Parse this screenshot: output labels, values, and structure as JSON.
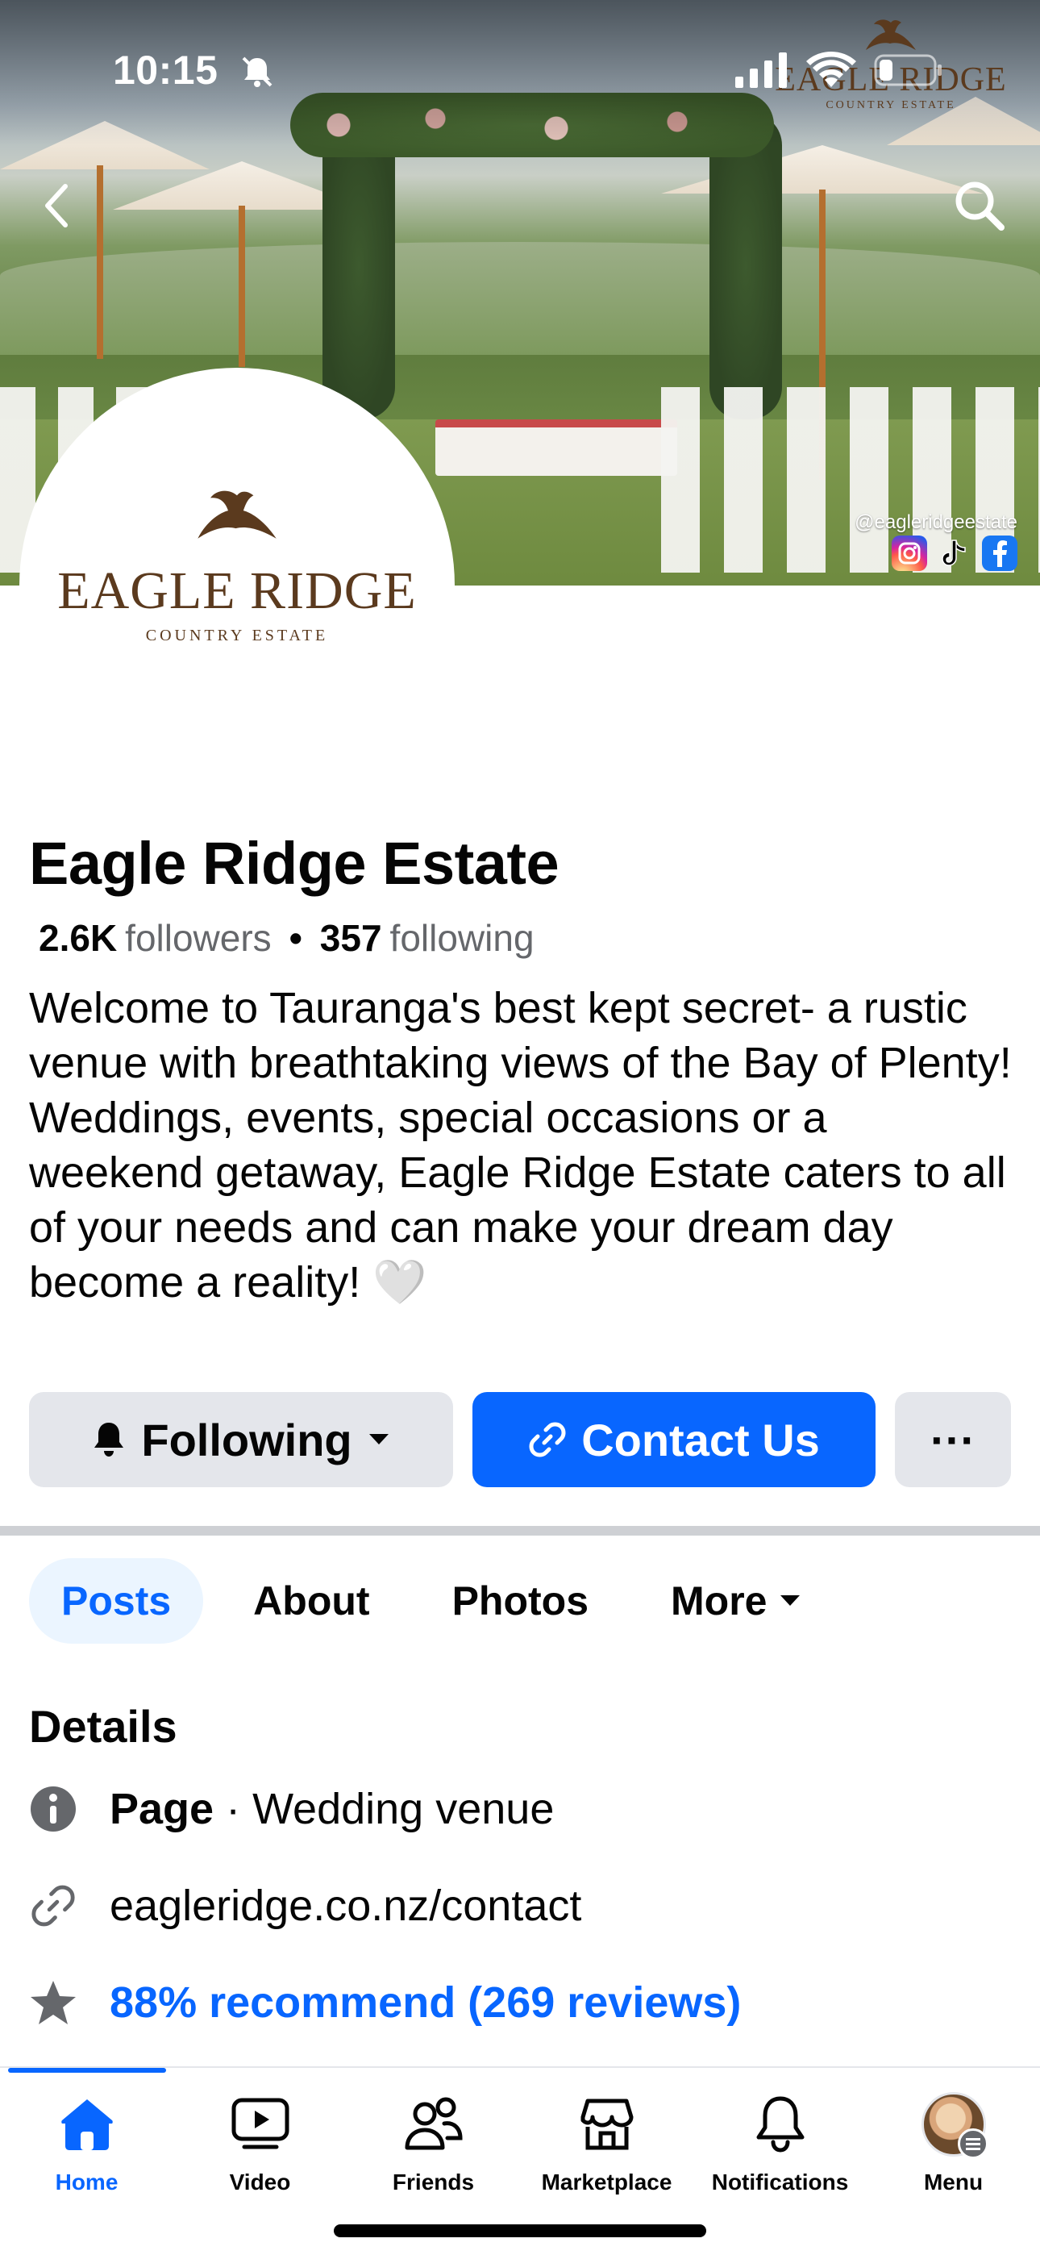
{
  "status_bar": {
    "time": "10:15",
    "icons": [
      "bell-slash-icon",
      "signal-icon",
      "wifi-icon",
      "battery-icon"
    ]
  },
  "cover": {
    "watermark_title": "EAGLE RIDGE",
    "watermark_subtitle": "COUNTRY ESTATE",
    "social_handle": "@eagleridgeestate",
    "social_icons": [
      "instagram-icon",
      "tiktok-icon",
      "facebook-icon"
    ]
  },
  "profile": {
    "logo_title": "EAGLE RIDGE",
    "logo_subtitle": "COUNTRY ESTATE",
    "name": "Eagle Ridge Estate",
    "followers_count": "2.6K",
    "followers_label": "followers",
    "following_count": "357",
    "following_label": "following",
    "separator": "•",
    "bio": "Welcome to Tauranga's best kept secret- a rustic venue with breathtaking views of the Bay of Plenty!\nWeddings, events, special occasions or a weekend getaway, Eagle Ridge Estate caters to all of your needs and can make your dream day become a reality! 🤍"
  },
  "actions": {
    "following_label": "Following",
    "contact_label": "Contact Us",
    "more_label": "···"
  },
  "tabs": [
    {
      "label": "Posts",
      "active": true
    },
    {
      "label": "About",
      "active": false
    },
    {
      "label": "Photos",
      "active": false
    },
    {
      "label": "More",
      "active": false
    }
  ],
  "details": {
    "title": "Details",
    "page_type_bold": "Page",
    "page_type_rest": " · Wedding venue",
    "link": "eagleridge.co.nz/contact",
    "reviews": "88% recommend (269 reviews)"
  },
  "bottom_nav": [
    {
      "label": "Home",
      "icon": "home-icon",
      "active": true
    },
    {
      "label": "Video",
      "icon": "video-icon",
      "active": false
    },
    {
      "label": "Friends",
      "icon": "friends-icon",
      "active": false
    },
    {
      "label": "Marketplace",
      "icon": "marketplace-icon",
      "active": false
    },
    {
      "label": "Notifications",
      "icon": "bell-icon",
      "active": false
    },
    {
      "label": "Menu",
      "icon": "avatar",
      "active": false
    }
  ],
  "colors": {
    "accent": "#0866ff",
    "button_gray": "#e4e6eb",
    "secondary_text": "#65676b",
    "brand_brown": "#5b3a1e"
  }
}
